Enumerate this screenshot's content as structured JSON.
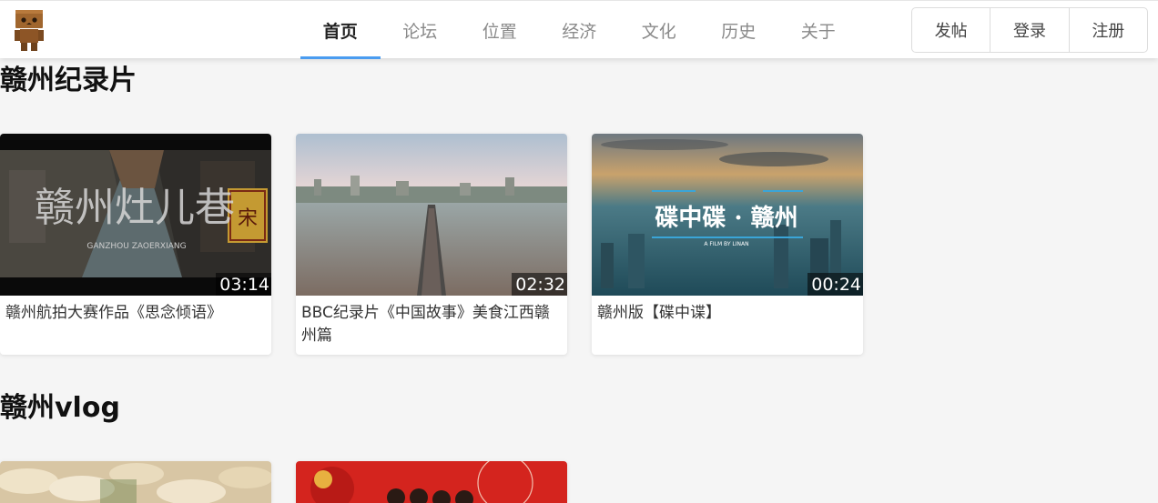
{
  "header": {
    "logo": "danbo-figure-logo",
    "nav": [
      {
        "label": "首页",
        "active": true
      },
      {
        "label": "论坛",
        "active": false
      },
      {
        "label": "位置",
        "active": false
      },
      {
        "label": "经济",
        "active": false
      },
      {
        "label": "文化",
        "active": false
      },
      {
        "label": "历史",
        "active": false
      },
      {
        "label": "关于",
        "active": false
      }
    ],
    "actions": {
      "post": "发帖",
      "login": "登录",
      "register": "注册"
    },
    "accent_color": "#4a9cf0"
  },
  "sections": {
    "documentary": {
      "title": "赣州纪录片",
      "videos": [
        {
          "title": "赣州航拍大赛作品《思念倾语》",
          "duration": "03:14",
          "overlay_title": "赣州灶儿巷",
          "overlay_subtitle": "GANZHOU   ZAOERXIANG",
          "sign_char": "宋"
        },
        {
          "title": "BBC纪录片《中国故事》美食江西赣州篇",
          "duration": "02:32"
        },
        {
          "title": "赣州版【碟中谍】",
          "duration": "00:24",
          "overlay_title": "碟中碟 · 赣州",
          "overlay_subtitle": "A FILM BY LINAN"
        }
      ]
    },
    "vlog": {
      "title": "赣州vlog"
    }
  }
}
